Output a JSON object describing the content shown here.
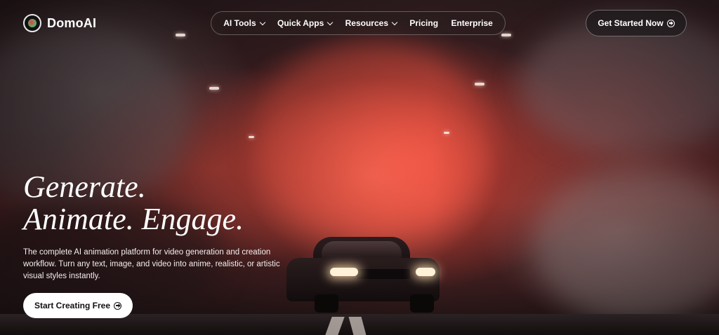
{
  "brand": {
    "name": "DomoAI",
    "logo_icon": "domoai-logo-icon"
  },
  "nav": {
    "items": [
      {
        "label": "AI Tools",
        "has_dropdown": true
      },
      {
        "label": "Quick Apps",
        "has_dropdown": true
      },
      {
        "label": "Resources",
        "has_dropdown": true
      },
      {
        "label": "Pricing",
        "has_dropdown": false
      },
      {
        "label": "Enterprise",
        "has_dropdown": false
      }
    ]
  },
  "header_cta": {
    "label": "Get Started Now",
    "icon": "arrow-circle-right-icon"
  },
  "hero": {
    "headline_line1": "Generate.",
    "headline_line2": "Animate. Engage.",
    "description": "The complete AI animation platform for video generation and creation workflow. Turn any text, image, and video into anime, realistic, or artistic visual styles instantly.",
    "cta": {
      "label": "Start Creating Free",
      "icon": "arrow-circle-right-icon"
    }
  },
  "colors": {
    "accent_red": "#e8463a",
    "button_light": "#ffffff",
    "button_dark": "#1e191b"
  }
}
